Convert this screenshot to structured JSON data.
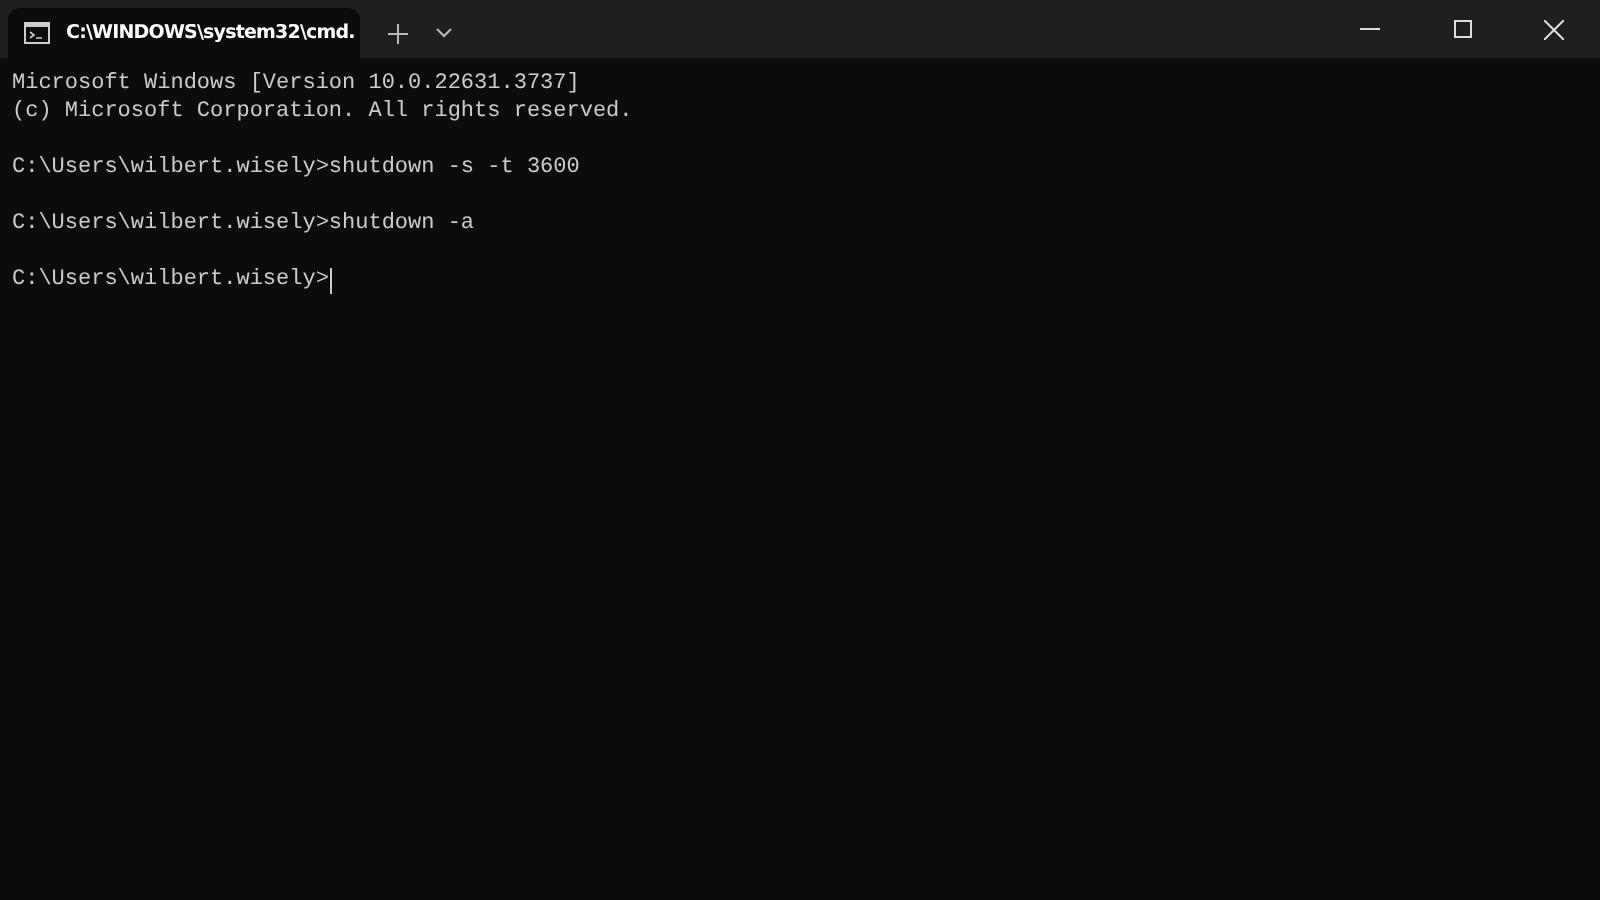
{
  "tabs": [
    {
      "title": "C:\\WINDOWS\\system32\\cmd.",
      "selected": true
    }
  ],
  "lines": [
    {
      "kind": "output",
      "text": "Microsoft Windows [Version 10.0.22631.3737]",
      "cursor": false
    },
    {
      "kind": "output",
      "text": "(c) Microsoft Corporation. All rights reserved.",
      "cursor": false
    },
    {
      "kind": "prompt",
      "text": "C:\\Users\\wilbert.wisely>shutdown -s -t 3600",
      "cursor": false
    },
    {
      "kind": "prompt",
      "text": "C:\\Users\\wilbert.wisely>shutdown -a",
      "cursor": false
    },
    {
      "kind": "prompt",
      "text": "C:\\Users\\wilbert.wisely>",
      "cursor": true
    }
  ]
}
